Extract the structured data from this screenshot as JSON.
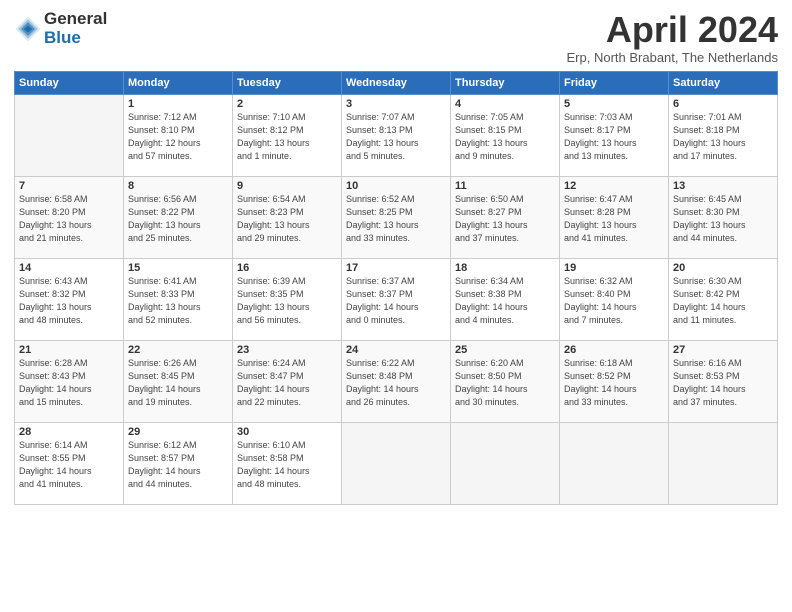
{
  "logo": {
    "general": "General",
    "blue": "Blue"
  },
  "title": "April 2024",
  "subtitle": "Erp, North Brabant, The Netherlands",
  "headers": [
    "Sunday",
    "Monday",
    "Tuesday",
    "Wednesday",
    "Thursday",
    "Friday",
    "Saturday"
  ],
  "weeks": [
    [
      {
        "day": "",
        "detail": ""
      },
      {
        "day": "1",
        "detail": "Sunrise: 7:12 AM\nSunset: 8:10 PM\nDaylight: 12 hours\nand 57 minutes."
      },
      {
        "day": "2",
        "detail": "Sunrise: 7:10 AM\nSunset: 8:12 PM\nDaylight: 13 hours\nand 1 minute."
      },
      {
        "day": "3",
        "detail": "Sunrise: 7:07 AM\nSunset: 8:13 PM\nDaylight: 13 hours\nand 5 minutes."
      },
      {
        "day": "4",
        "detail": "Sunrise: 7:05 AM\nSunset: 8:15 PM\nDaylight: 13 hours\nand 9 minutes."
      },
      {
        "day": "5",
        "detail": "Sunrise: 7:03 AM\nSunset: 8:17 PM\nDaylight: 13 hours\nand 13 minutes."
      },
      {
        "day": "6",
        "detail": "Sunrise: 7:01 AM\nSunset: 8:18 PM\nDaylight: 13 hours\nand 17 minutes."
      }
    ],
    [
      {
        "day": "7",
        "detail": "Sunrise: 6:58 AM\nSunset: 8:20 PM\nDaylight: 13 hours\nand 21 minutes."
      },
      {
        "day": "8",
        "detail": "Sunrise: 6:56 AM\nSunset: 8:22 PM\nDaylight: 13 hours\nand 25 minutes."
      },
      {
        "day": "9",
        "detail": "Sunrise: 6:54 AM\nSunset: 8:23 PM\nDaylight: 13 hours\nand 29 minutes."
      },
      {
        "day": "10",
        "detail": "Sunrise: 6:52 AM\nSunset: 8:25 PM\nDaylight: 13 hours\nand 33 minutes."
      },
      {
        "day": "11",
        "detail": "Sunrise: 6:50 AM\nSunset: 8:27 PM\nDaylight: 13 hours\nand 37 minutes."
      },
      {
        "day": "12",
        "detail": "Sunrise: 6:47 AM\nSunset: 8:28 PM\nDaylight: 13 hours\nand 41 minutes."
      },
      {
        "day": "13",
        "detail": "Sunrise: 6:45 AM\nSunset: 8:30 PM\nDaylight: 13 hours\nand 44 minutes."
      }
    ],
    [
      {
        "day": "14",
        "detail": "Sunrise: 6:43 AM\nSunset: 8:32 PM\nDaylight: 13 hours\nand 48 minutes."
      },
      {
        "day": "15",
        "detail": "Sunrise: 6:41 AM\nSunset: 8:33 PM\nDaylight: 13 hours\nand 52 minutes."
      },
      {
        "day": "16",
        "detail": "Sunrise: 6:39 AM\nSunset: 8:35 PM\nDaylight: 13 hours\nand 56 minutes."
      },
      {
        "day": "17",
        "detail": "Sunrise: 6:37 AM\nSunset: 8:37 PM\nDaylight: 14 hours\nand 0 minutes."
      },
      {
        "day": "18",
        "detail": "Sunrise: 6:34 AM\nSunset: 8:38 PM\nDaylight: 14 hours\nand 4 minutes."
      },
      {
        "day": "19",
        "detail": "Sunrise: 6:32 AM\nSunset: 8:40 PM\nDaylight: 14 hours\nand 7 minutes."
      },
      {
        "day": "20",
        "detail": "Sunrise: 6:30 AM\nSunset: 8:42 PM\nDaylight: 14 hours\nand 11 minutes."
      }
    ],
    [
      {
        "day": "21",
        "detail": "Sunrise: 6:28 AM\nSunset: 8:43 PM\nDaylight: 14 hours\nand 15 minutes."
      },
      {
        "day": "22",
        "detail": "Sunrise: 6:26 AM\nSunset: 8:45 PM\nDaylight: 14 hours\nand 19 minutes."
      },
      {
        "day": "23",
        "detail": "Sunrise: 6:24 AM\nSunset: 8:47 PM\nDaylight: 14 hours\nand 22 minutes."
      },
      {
        "day": "24",
        "detail": "Sunrise: 6:22 AM\nSunset: 8:48 PM\nDaylight: 14 hours\nand 26 minutes."
      },
      {
        "day": "25",
        "detail": "Sunrise: 6:20 AM\nSunset: 8:50 PM\nDaylight: 14 hours\nand 30 minutes."
      },
      {
        "day": "26",
        "detail": "Sunrise: 6:18 AM\nSunset: 8:52 PM\nDaylight: 14 hours\nand 33 minutes."
      },
      {
        "day": "27",
        "detail": "Sunrise: 6:16 AM\nSunset: 8:53 PM\nDaylight: 14 hours\nand 37 minutes."
      }
    ],
    [
      {
        "day": "28",
        "detail": "Sunrise: 6:14 AM\nSunset: 8:55 PM\nDaylight: 14 hours\nand 41 minutes."
      },
      {
        "day": "29",
        "detail": "Sunrise: 6:12 AM\nSunset: 8:57 PM\nDaylight: 14 hours\nand 44 minutes."
      },
      {
        "day": "30",
        "detail": "Sunrise: 6:10 AM\nSunset: 8:58 PM\nDaylight: 14 hours\nand 48 minutes."
      },
      {
        "day": "",
        "detail": ""
      },
      {
        "day": "",
        "detail": ""
      },
      {
        "day": "",
        "detail": ""
      },
      {
        "day": "",
        "detail": ""
      }
    ]
  ]
}
